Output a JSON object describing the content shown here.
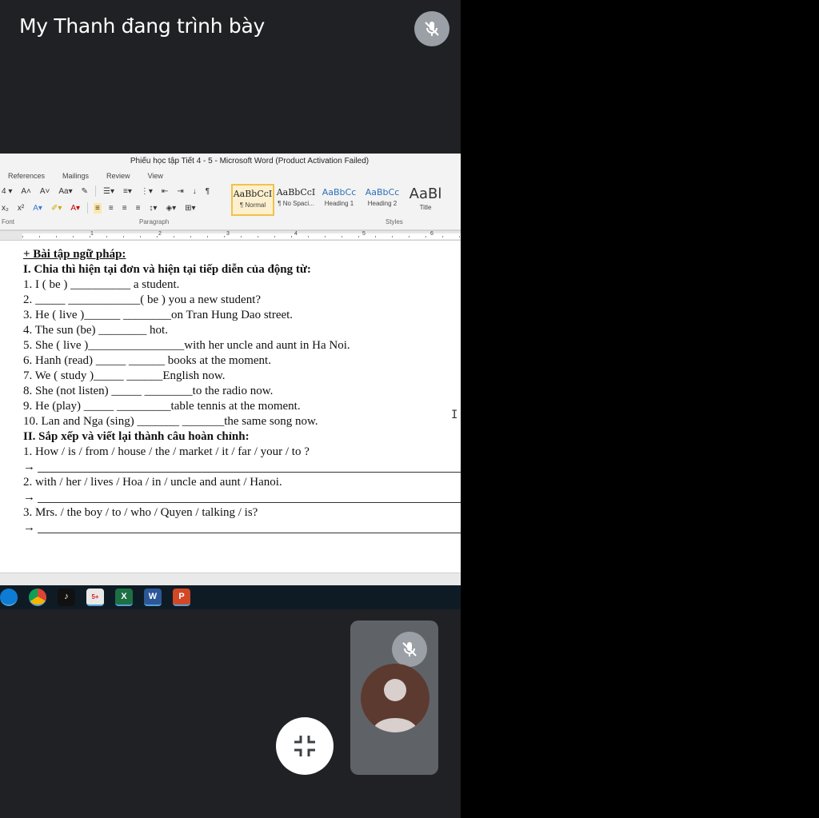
{
  "meet": {
    "presenter_title": "My Thanh đang trình bày"
  },
  "word": {
    "title": "Phiếu học tập  Tiết 4 - 5  -  Microsoft Word (Product Activation Failed)",
    "tabs": [
      "References",
      "Mailings",
      "Review",
      "View"
    ],
    "groups": {
      "font": "Font",
      "paragraph": "Paragraph",
      "styles": "Styles"
    },
    "styles": [
      {
        "sample": "AaBbCcI",
        "name": "¶ Normal"
      },
      {
        "sample": "AaBbCcI",
        "name": "¶ No Spaci..."
      },
      {
        "sample": "AaBbCc",
        "name": "Heading 1"
      },
      {
        "sample": "AaBbCc",
        "name": "Heading 2"
      },
      {
        "sample": "AaBl",
        "name": "Title"
      }
    ],
    "ruler_numbers": [
      "1",
      "2",
      "3",
      "4",
      "5",
      "6"
    ]
  },
  "document": {
    "section_title": "+  Bài tập ngữ pháp:",
    "part1_heading": "I. Chia thì hiện tại đơn và hiện tại tiếp diễn của động từ:",
    "ex1": "1. I ( be ) __________ a student.",
    "ex2": "2. _____ ____________( be ) you a new student?",
    "ex3": "3. He ( live )______ ________on Tran Hung Dao street.",
    "ex4": "4. The sun (be) ________ hot.",
    "ex5": "5. She ( live )________________with her uncle and aunt in Ha Noi.",
    "ex6": "6. Hanh (read) _____ ______ books at the moment.",
    "ex7": "7. We ( study )_____ ______English now.",
    "ex8": "8. She (not listen) _____ ________to the radio now.",
    "ex9": "9. He (play) _____ _________table tennis at the moment.",
    "ex10": "10. Lan and Nga (sing) _______ _______the same song now.",
    "part2_heading": "II. Sắp xếp và viết lại thành câu hoàn chỉnh:",
    "s1": "1. How / is / from / house / the / market / it / far / your / to ?",
    "s2": "2.   with / her / lives / Hoa / in / uncle and aunt / Hanoi.",
    "s3": "3.  Mrs. / the boy / to / who / Quyen / talking / is?",
    "arrow": "→"
  },
  "taskbar": {
    "apps": [
      "edge-icon",
      "chrome-icon",
      "tiktok-icon",
      "messenger-icon",
      "excel-icon",
      "word-icon",
      "powerpoint-icon"
    ],
    "labels": [
      "",
      "",
      "",
      "5+",
      "X",
      "W",
      "P"
    ]
  },
  "colors": {
    "meet_bg": "#202124",
    "mic_bg": "#9aa0a6",
    "avatar_bg": "#5d3a30"
  }
}
